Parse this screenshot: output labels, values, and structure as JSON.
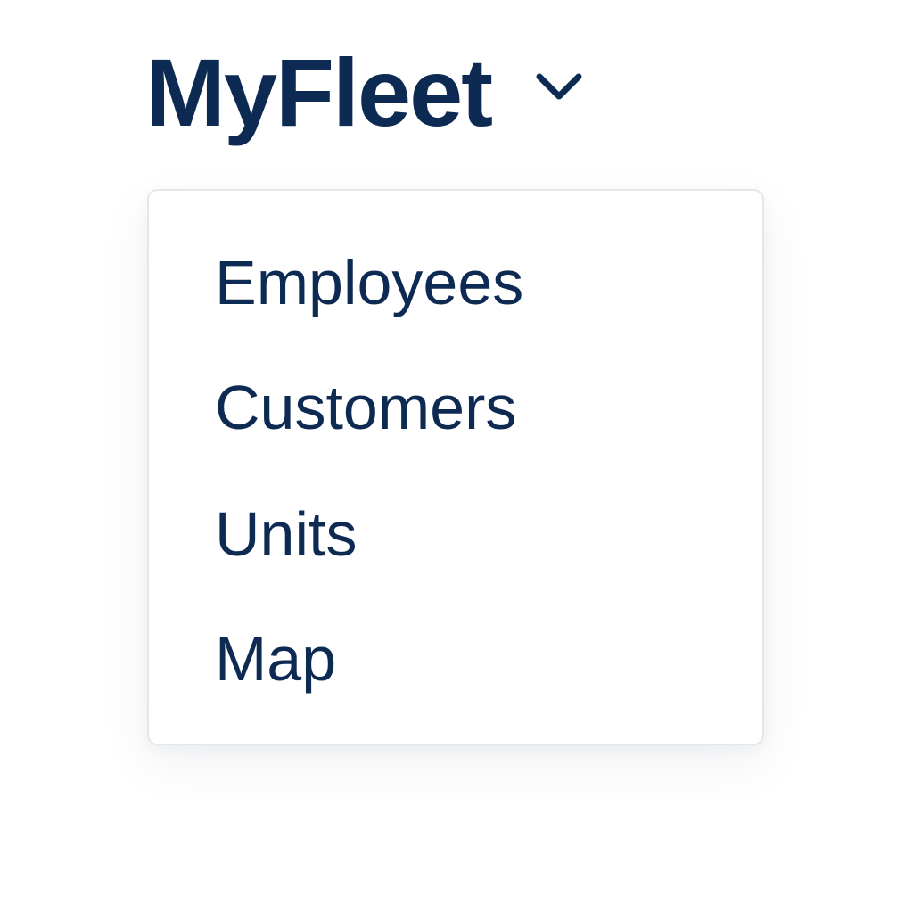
{
  "brand": {
    "title": "MyFleet",
    "toggle_icon": "chevron-down-icon"
  },
  "colors": {
    "text": "#0d2a52",
    "menu_border": "#e3e7ec",
    "background": "#ffffff"
  },
  "menu": {
    "items": [
      {
        "label": "Employees"
      },
      {
        "label": "Customers"
      },
      {
        "label": "Units"
      },
      {
        "label": "Map"
      }
    ]
  }
}
